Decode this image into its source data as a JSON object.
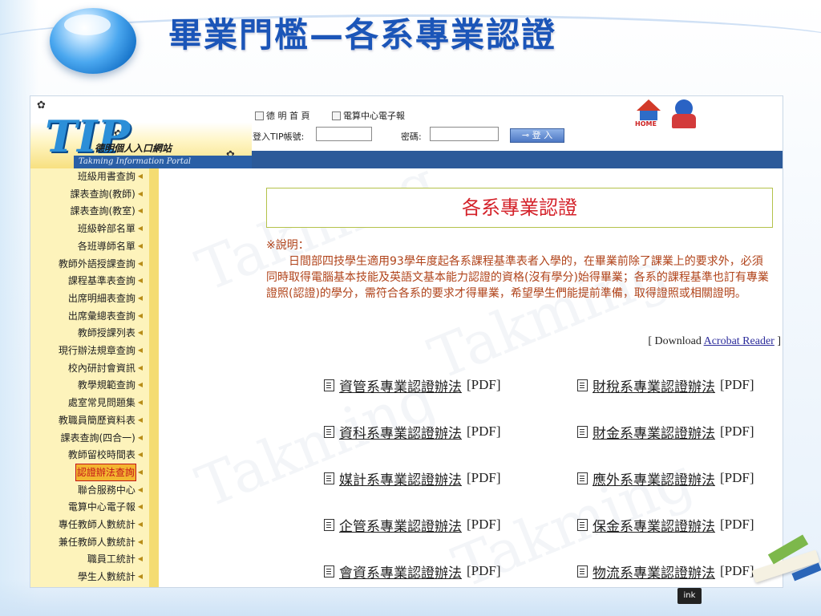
{
  "slide": {
    "title": "畢業門檻—各系專業認證"
  },
  "header": {
    "logo_text": "TIP",
    "logo_subtitle": "德明個人入口網站",
    "logo_english": "Takming Information Portal",
    "links": [
      "德 明 首 頁",
      "電算中心電子報"
    ],
    "login": {
      "account_label": "登入TIP帳號:",
      "account_value": "",
      "password_label": "密碼:",
      "password_value": "",
      "button_label": "登 入"
    },
    "home_label": "HOME"
  },
  "sidebar": {
    "items": [
      {
        "label": "班級用書查詢"
      },
      {
        "label": "課表查詢(教師)"
      },
      {
        "label": "課表查詢(教室)"
      },
      {
        "label": "班級幹部名單"
      },
      {
        "label": "各班導師名單"
      },
      {
        "label": "教師外語授課查詢"
      },
      {
        "label": "課程基準表查詢"
      },
      {
        "label": "出席明細表查詢"
      },
      {
        "label": "出席彙總表查詢"
      },
      {
        "label": "教師授課列表"
      },
      {
        "label": "現行辦法規章查詢"
      },
      {
        "label": "校內研討會資訊"
      },
      {
        "label": "教學規範查詢"
      },
      {
        "label": "處室常見問題集"
      },
      {
        "label": "教職員簡歷資料表"
      },
      {
        "label": "課表查詢(四合一)"
      },
      {
        "label": "教師留校時間表"
      },
      {
        "label": "認證辦法查詢",
        "active": true
      },
      {
        "label": "聯合服務中心"
      },
      {
        "label": "電算中心電子報"
      },
      {
        "label": "專任教師人數統計"
      },
      {
        "label": "兼任教師人數統計"
      },
      {
        "label": "職員工統計"
      },
      {
        "label": "學生人數統計"
      }
    ]
  },
  "main": {
    "watermark": "Takming",
    "heading": "各系專業認證",
    "note_label": "※說明：",
    "note_text": "日間部四技學生適用93學年度起各系課程基準表者入學的，在畢業前除了課業上的要求外，必須同時取得電腦基本技能及英語文基本能力認證的資格(沒有學分)始得畢業；各系的課程基準也訂有專業證照(認證)的學分，需符合各系的要求才得畢業，希望學生們能提前準備，取得證照或相關證明。",
    "download_prefix": "[ Download",
    "download_link": "Acrobat Reader",
    "download_suffix": "]",
    "pdf_tag": "[PDF]",
    "documents": [
      [
        "資管系專業認證辦法",
        "財稅系專業認證辦法"
      ],
      [
        "資科系專業認證辦法",
        "財金系專業認證辦法"
      ],
      [
        "媒計系專業認證辦法",
        "應外系專業認證辦法"
      ],
      [
        "企管系專業認證辦法",
        "保金系專業認證辦法"
      ],
      [
        "會資系專業認證辦法",
        "物流系專業認證辦法"
      ]
    ]
  },
  "decor": {
    "ink_label": "ink"
  }
}
